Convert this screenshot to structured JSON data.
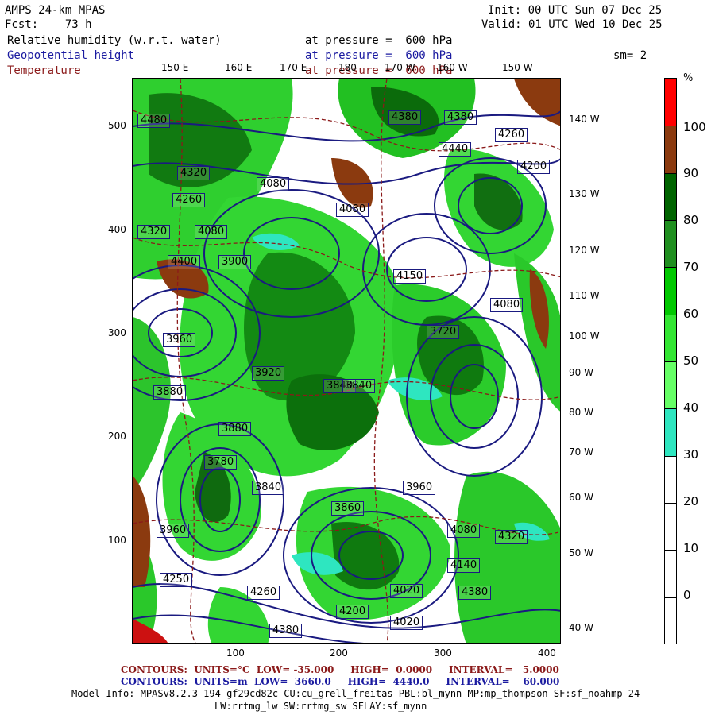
{
  "header": {
    "model": "AMPS 24-km MPAS",
    "forecast": "Fcst:    73 h",
    "init": "Init: 00 UTC Sun 07 Dec 25",
    "valid": "Valid: 01 UTC Wed 10 Dec 25",
    "fields": [
      {
        "name": "Relative humidity (w.r.t. water)",
        "level": "at pressure =  600 hPa",
        "color": "#000000"
      },
      {
        "name": "Geopotential height",
        "level": "at pressure =  600 hPa",
        "color": "#1a1aa0"
      },
      {
        "name": "Temperature",
        "level": "at pressure =  600 hPa",
        "color": "#8b1a1a"
      }
    ],
    "smoothing": "sm= 2"
  },
  "axes": {
    "top_lon": [
      "150 E",
      "160 E",
      "170 E",
      "180",
      "170 W",
      "160 W",
      "150 W"
    ],
    "right_lon": [
      "140 W",
      "130 W",
      "120 W",
      "110 W",
      "100 W",
      "90 W",
      "80 W",
      "70 W",
      "60 W",
      "50 W",
      "40 W"
    ],
    "left_y": [
      "500",
      "400",
      "300",
      "200",
      "100"
    ],
    "bottom_x": [
      "100",
      "200",
      "300",
      "400"
    ]
  },
  "legend": {
    "unit": "%",
    "labels": [
      "100",
      "90",
      "80",
      "70",
      "60",
      "50",
      "40",
      "30",
      "20",
      "10",
      "0"
    ],
    "colors": [
      "#ff0000",
      "#8b3a0f",
      "#006400",
      "#1f8f1f",
      "#00c800",
      "#33e633",
      "#66ff66",
      "#2ee6c0",
      "#ffffff",
      "#ffffff",
      "#ffffff",
      "#ffffff"
    ]
  },
  "height_labels": [
    "4480",
    "4380",
    "4380",
    "4260",
    "4320",
    "4440",
    "4200",
    "4260",
    "4080",
    "4080",
    "4320",
    "4080",
    "4400",
    "3900",
    "4150",
    "4080",
    "3960",
    "3920",
    "3840",
    "3720",
    "3880",
    "3780",
    "3840",
    "3960",
    "3860",
    "3880",
    "4080",
    "4320",
    "4140",
    "4020",
    "4380",
    "4200",
    "4260",
    "4380",
    "4020",
    "3960",
    "4250",
    "3840"
  ],
  "footer": {
    "temp_contours": "CONTOURS:  UNITS=°C  LOW= -35.000     HIGH=  0.0000     INTERVAL=   5.0000",
    "height_contours": "CONTOURS:  UNITS=m  LOW=  3660.0     HIGH=  4440.0     INTERVAL=    60.000",
    "model_info": "Model Info: MPASv8.2.3-194-gf29cd82c CU:cu_grell_freitas PBL:bl_mynn MP:mp_thompson SF:sf_noahmp 24",
    "model_info2": "LW:rrtmg_lw SW:rrtmg_sw SFLAY:sf_mynn"
  }
}
